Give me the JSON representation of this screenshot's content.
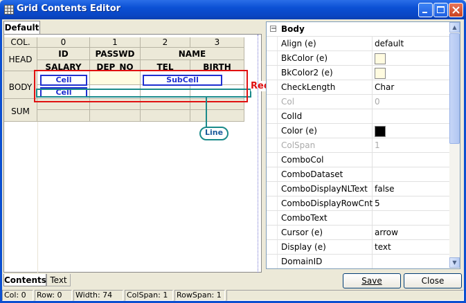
{
  "window": {
    "title": "Grid Contents Editor"
  },
  "tabs": {
    "top": "Default",
    "bottom": [
      "Contents",
      "Text"
    ]
  },
  "grid": {
    "col_label": "COL.",
    "columns": [
      "0",
      "1",
      "2",
      "3"
    ],
    "row_labels": {
      "head": "HEAD",
      "body": "BODY",
      "sum": "SUM"
    },
    "head": {
      "row1": [
        "ID",
        "PASSWD",
        "NAME"
      ],
      "row2": [
        "SALARY",
        "DEP_NO",
        "TEL",
        "BIRTH"
      ]
    },
    "cells": {
      "cell1": "Cell",
      "subcell": "SubCell",
      "cell2": "Cell"
    },
    "annotations": {
      "record": "Record",
      "line": "Line"
    }
  },
  "properties": {
    "section": "Body",
    "rows": [
      {
        "name": "Align (e)",
        "value": "default"
      },
      {
        "name": "BkColor (e)",
        "value": "",
        "swatch": "#fffbe0"
      },
      {
        "name": "BkColor2 (e)",
        "value": "",
        "swatch": "#fffbe0"
      },
      {
        "name": "CheckLength",
        "value": "Char"
      },
      {
        "name": "Col",
        "value": "0",
        "disabled": true
      },
      {
        "name": "ColId",
        "value": ""
      },
      {
        "name": "Color (e)",
        "value": "",
        "swatch": "#000000"
      },
      {
        "name": "ColSpan",
        "value": "1",
        "disabled": true
      },
      {
        "name": "ComboCol",
        "value": ""
      },
      {
        "name": "ComboDataset",
        "value": ""
      },
      {
        "name": "ComboDisplayNLText",
        "value": "false"
      },
      {
        "name": "ComboDisplayRowCnt",
        "value": "5"
      },
      {
        "name": "ComboText",
        "value": ""
      },
      {
        "name": "Cursor (e)",
        "value": "arrow"
      },
      {
        "name": "Display (e)",
        "value": "text"
      },
      {
        "name": "DomainID",
        "value": ""
      }
    ]
  },
  "buttons": {
    "save": "Save",
    "close": "Close"
  },
  "status": [
    "Col: 0",
    "Row: 0",
    "Width: 74",
    "ColSpan: 1",
    "RowSpan: 1"
  ]
}
